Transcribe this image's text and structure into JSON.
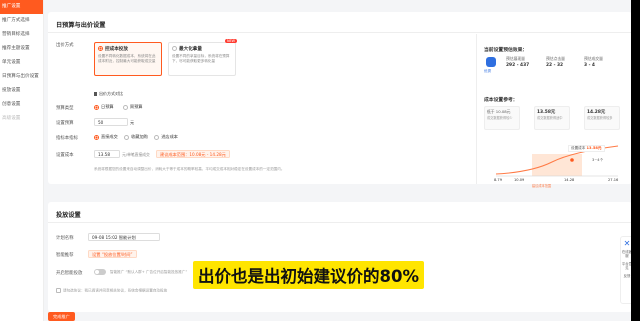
{
  "sidebar": {
    "items": [
      {
        "label": "推广设置",
        "active": true
      },
      {
        "label": "推广方式选择"
      },
      {
        "label": "营销目标选择"
      },
      {
        "label": "推荐主题设置"
      },
      {
        "label": "单元设置"
      },
      {
        "label": "日预算与出价设置"
      },
      {
        "label": "投放设置"
      },
      {
        "label": "创意设置"
      },
      {
        "label": "高级设置"
      }
    ]
  },
  "budget_card": {
    "title": "日预算与出价设置",
    "bid_method_label": "出价方式",
    "options": [
      {
        "title": "控成本投放",
        "desc": "设置不同转化数据成本，系统将在此成本附近，控制最大可能获取成交量",
        "selected": true
      },
      {
        "title": "最大化拿量",
        "desc": "设置不同的拿量目标，系统将在预算下，尽可能获取更多转化量",
        "selected": false,
        "badge": "NEW"
      }
    ],
    "link": "出价方式对比",
    "budget_type_label": "预算类型",
    "budget_type_options": [
      "日预算",
      "周预算"
    ],
    "budget_label": "设置预算",
    "budget_value": "50",
    "budget_unit": "元",
    "cost_type_label": "指标本指标",
    "cost_type_options": [
      "直接成交",
      "收藏加购",
      "进店成本"
    ],
    "cost_label": "设置成本",
    "cost_value": "13.58",
    "cost_hint": "元/单笔直接成交",
    "suggest_chip": "建议成本范围：10.08元 - 14.28元",
    "footnote": "系统将根据您的设置来自动调整出价，消耗大于等于成本的概率较高，平均成交成本相对稳定在设置成本的一定范围内。"
  },
  "right_panel": {
    "forecast_title": "当前设置预估效果：",
    "badge": "优秀",
    "stats": [
      {
        "label": "预估展现量",
        "value": "292 - 437"
      },
      {
        "label": "预估点击量",
        "value": "22 - 32"
      },
      {
        "label": "预估成交量",
        "value": "3 - 4"
      }
    ],
    "cost_ref_title": "成本设置参考：",
    "suggestions": [
      {
        "title": "低于 10.08元",
        "desc": "成交数据获得较少"
      },
      {
        "title": "13.58元",
        "desc": "成交数据获得适中"
      },
      {
        "title": "14.28元",
        "desc": "成交数据获得较多"
      }
    ],
    "current_tag": "设置成本",
    "current_value": "13.58元",
    "axis_ticks": [
      "8.79",
      "10.09",
      "14.28",
      "27.16"
    ],
    "range_label": "建议成本范围",
    "right_tick": "3~4个"
  },
  "delivery_card": {
    "title": "投放设置",
    "plan_name_label": "计划名称",
    "plan_name_value": "09-08 15:02 智能计划",
    "target_label": "智能推荐",
    "target_chip": "设置 “投放位置/时间”",
    "toggle_label": "开启智能投放",
    "toggle_hint": "智能推广 “默认人群+ 广告位开启智能投放推广”",
    "agree_label": "请勾选协议：我已阅读并同意相关协议，系统会根据设置自动投放",
    "submit_label": "完成推广"
  },
  "caption": "出价也是出初始建议价的80%",
  "float_panel": {
    "items": [
      "在线客服",
      "平台意见",
      "反馈"
    ]
  },
  "colors": {
    "accent": "#ff5a1f",
    "caption_bg": "#ffe500",
    "badge_blue": "#2f6fe0"
  }
}
